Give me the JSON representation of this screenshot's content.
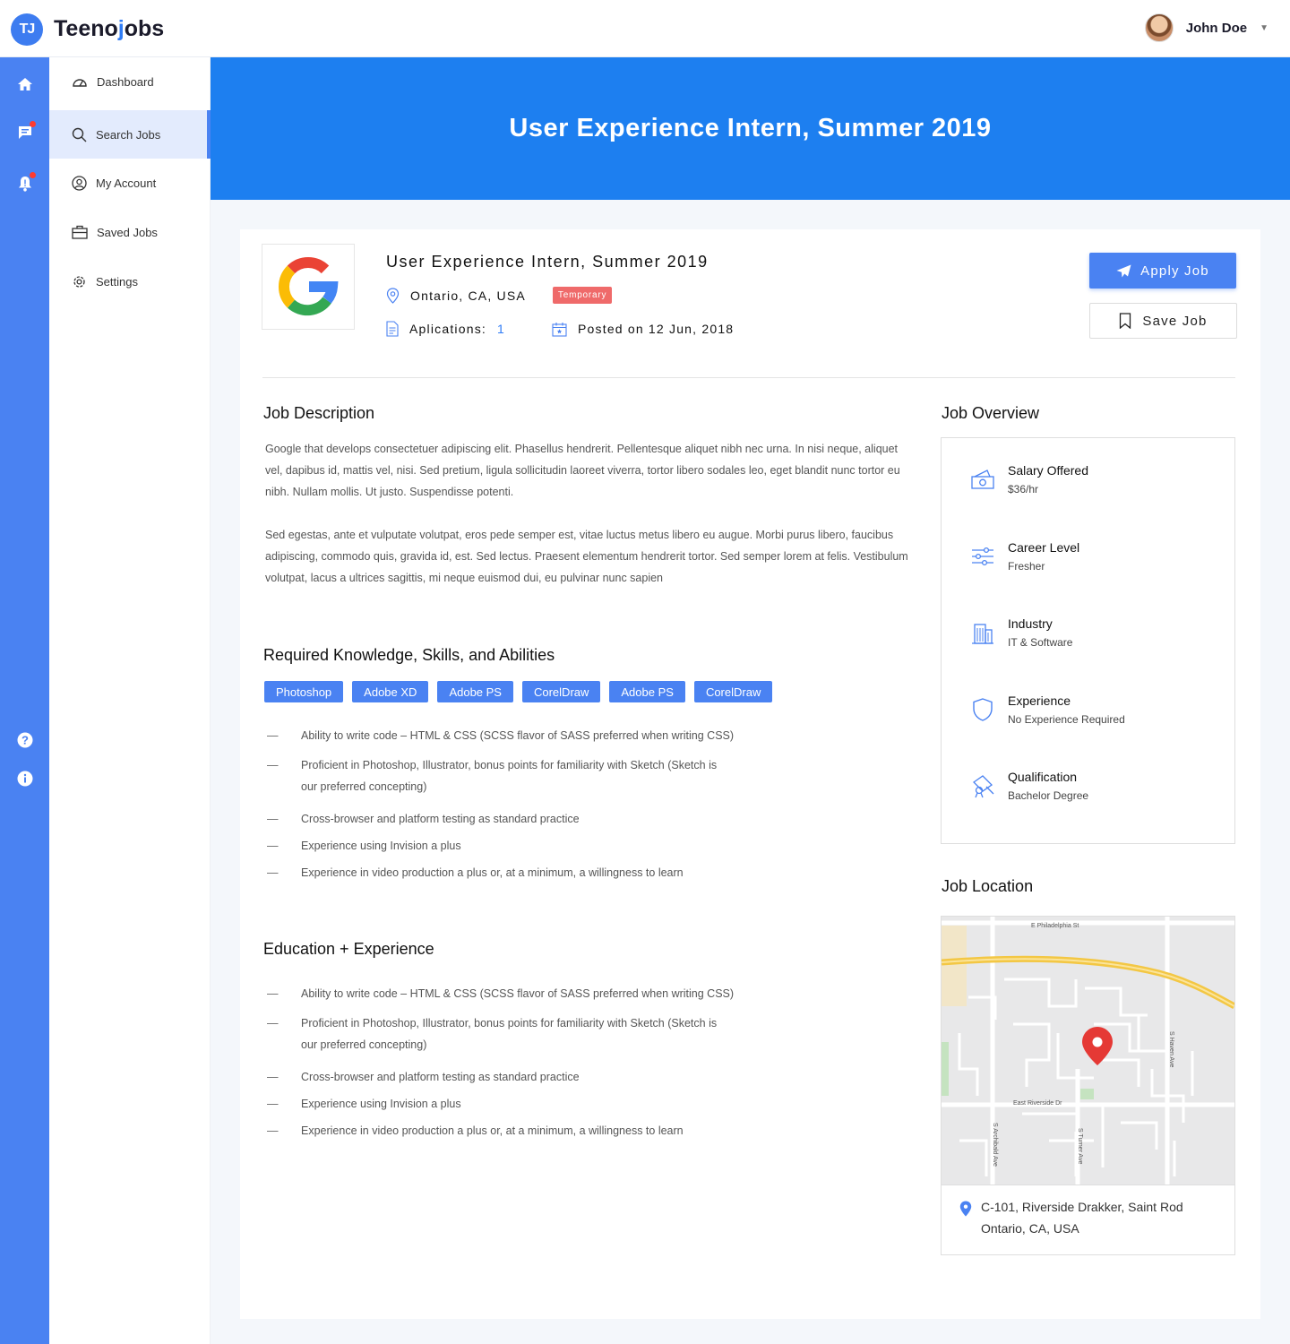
{
  "brand": {
    "name_prefix": "Teeno",
    "name_accent": "j",
    "name_suffix": "obs",
    "badge": "TJ"
  },
  "user": {
    "name": "John Doe"
  },
  "sidebar": {
    "items": [
      {
        "label": "Dashboard",
        "icon": "dashboard-icon"
      },
      {
        "label": "Search Jobs",
        "icon": "search-icon",
        "active": true
      },
      {
        "label": "My Account",
        "icon": "account-icon"
      },
      {
        "label": "Saved Jobs",
        "icon": "briefcase-icon"
      },
      {
        "label": "Settings",
        "icon": "gear-icon"
      }
    ]
  },
  "hero": {
    "title": "User Experience Intern, Summer 2019"
  },
  "job": {
    "title": "User Experience Intern, Summer 2019",
    "location": "Ontario, CA, USA",
    "type_badge": "Temporary",
    "applications_label": "Aplications:",
    "applications_count": "1",
    "posted": "Posted on 12 Jun, 2018",
    "apply_label": "Apply Job",
    "save_label": "Save Job"
  },
  "description": {
    "title": "Job Description",
    "p1": "Google that develops consectetuer adipiscing elit. Phasellus hendrerit. Pellentesque aliquet nibh nec urna. In nisi neque, aliquet vel, dapibus id, mattis vel, nisi. Sed pretium, ligula sollicitudin laoreet viverra, tortor libero sodales leo, eget blandit nunc tortor eu nibh. Nullam mollis. Ut justo. Suspendisse potenti.",
    "p2": "Sed egestas, ante et vulputate volutpat, eros pede semper est, vitae luctus metus libero eu augue. Morbi purus libero, faucibus adipiscing, commodo quis, gravida id, est. Sed lectus. Praesent elementum hendrerit tortor. Sed semper lorem at felis. Vestibulum volutpat, lacus a ultrices sagittis, mi neque euismod dui, eu pulvinar nunc sapien"
  },
  "skills": {
    "title": "Required Knowledge, Skills, and Abilities",
    "tags": [
      "Photoshop",
      "Adobe XD",
      "Adobe PS",
      "CorelDraw",
      "Adobe PS",
      "CorelDraw"
    ],
    "bullets": [
      "Ability to write code – HTML & CSS (SCSS flavor of SASS preferred when writing CSS)",
      "Proficient in Photoshop, Illustrator, bonus points for familiarity with Sketch (Sketch is our preferred concepting)",
      "Cross-browser and platform testing as standard practice",
      "Experience using Invision a plus",
      "Experience in video production a plus or, at a minimum, a willingness to learn"
    ]
  },
  "education": {
    "title": "Education + Experience",
    "bullets": [
      "Ability to write code – HTML & CSS (SCSS flavor of SASS preferred when writing CSS)",
      "Proficient in Photoshop, Illustrator, bonus points for familiarity with Sketch (Sketch is our preferred concepting)",
      "Cross-browser and platform testing as standard practice",
      "Experience using Invision a plus",
      "Experience in video production a plus or, at a minimum, a willingness to learn"
    ]
  },
  "overview": {
    "title": "Job Overview",
    "items": [
      {
        "label": "Salary Offered",
        "value": "$36/hr",
        "icon": "salary-icon"
      },
      {
        "label": "Career Level",
        "value": "Fresher",
        "icon": "sliders-icon"
      },
      {
        "label": "Industry",
        "value": "IT & Software",
        "icon": "building-icon"
      },
      {
        "label": "Experience",
        "value": "No Experience Required",
        "icon": "shield-icon"
      },
      {
        "label": "Qualification",
        "value": "Bachelor Degree",
        "icon": "diploma-icon"
      }
    ]
  },
  "location": {
    "title": "Job Location",
    "address_line1": "C-101, Riverside Drakker, Saint Rod",
    "address_line2": "Ontario, CA, USA",
    "map_labels": {
      "street1": "E Philadelphia St",
      "street2": "East Riverside Dr",
      "street3": "S Haven Ave",
      "street4": "S Archibald Ave",
      "street5": "S Turner Ave"
    }
  },
  "colors": {
    "primary": "#4a82f2",
    "hero": "#1d7ff0",
    "badge": "#ef6a6a",
    "pin": "#e53935"
  }
}
